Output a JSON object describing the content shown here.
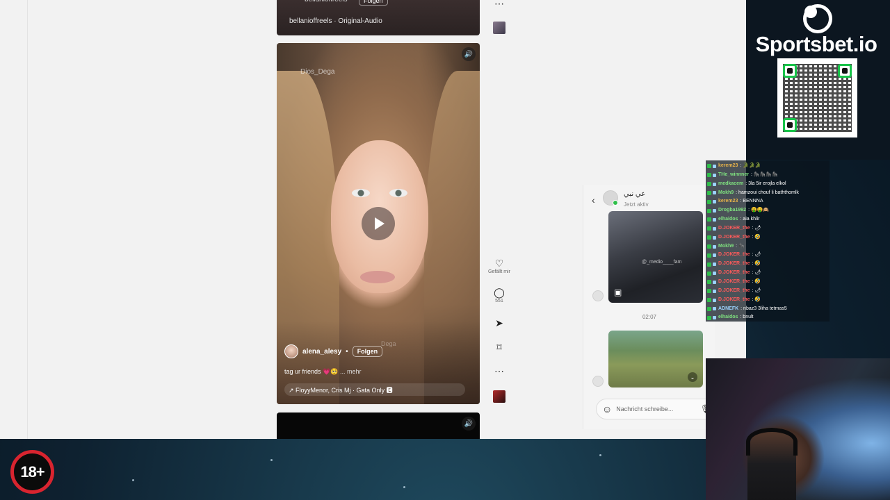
{
  "reels": {
    "top": {
      "username": "bellanioffreels",
      "follow": "Folgen",
      "audio": "bellanioffreels · Original-Audio"
    },
    "main": {
      "watermark": "Dios_Dega",
      "watermark2": "Dega",
      "username": "alena_alesy",
      "separator": "•",
      "follow": "Folgen",
      "caption": "tag ur friends 💗🥺",
      "more": "... mehr",
      "audio": "↗ FloyyMenor, Cris Mj · Gata Only 🅴"
    },
    "actions": {
      "like_label": "Gefällt mir",
      "comment_count": "551"
    }
  },
  "dm": {
    "name": "عي نبي",
    "status": "Jetzt aktiv",
    "media_caption": "@_medio____fam",
    "time": "02:07",
    "input_placeholder": "Nachricht schreibe..."
  },
  "overlay": {
    "sponsor": "Sportsbet.io",
    "age_rating": "18+"
  },
  "chat": [
    {
      "user": "kerem23",
      "color": "#e6b24a",
      "msg": ": 🐊🐊🐊"
    },
    {
      "user": "THe_winnner",
      "color": "#7fe07f",
      "msg": ": 🦍🦍🦍🦍"
    },
    {
      "user": "medkacem",
      "color": "#7fe07f",
      "msg": ": 3la 5ir erojla elkol"
    },
    {
      "user": "Mokh9",
      "color": "#7fe07f",
      "msg": ": hamzoui chouf li baththomlk"
    },
    {
      "user": "kerem23",
      "color": "#e6b24a",
      "msg": ": BENNNA"
    },
    {
      "user": "Drogba1992",
      "color": "#7fe07f",
      "msg": ": 🤑🤑🙉"
    },
    {
      "user": "elhaidos",
      "color": "#7fe07f",
      "msg": ": aia khlir"
    },
    {
      "user": "D.JOKER_the",
      "color": "#ff5a5a",
      "msg": ": 🌶"
    },
    {
      "user": "D.JOKER_the",
      "color": "#ff5a5a",
      "msg": ": 🤣"
    },
    {
      "user": "Mokh9",
      "color": "#7fe07f",
      "msg": ": 🦍"
    },
    {
      "user": "D.JOKER_the",
      "color": "#ff5a5a",
      "msg": ": 🌶"
    },
    {
      "user": "D.JOKER_the",
      "color": "#ff5a5a",
      "msg": ": 🤣"
    },
    {
      "user": "D.JOKER_the",
      "color": "#ff5a5a",
      "msg": ": 🌶"
    },
    {
      "user": "D.JOKER_the",
      "color": "#ff5a5a",
      "msg": ": 🤣"
    },
    {
      "user": "D.JOKER_the",
      "color": "#ff5a5a",
      "msg": ": 🌶"
    },
    {
      "user": "D.JOKER_the",
      "color": "#ff5a5a",
      "msg": ": 🤣"
    },
    {
      "user": "ADNEFK",
      "color": "#9bd3ff",
      "msg": ": nbaz3 3liha tetmas5"
    },
    {
      "user": "elhaidos",
      "color": "#7fe07f",
      "msg": ": bnult"
    }
  ]
}
